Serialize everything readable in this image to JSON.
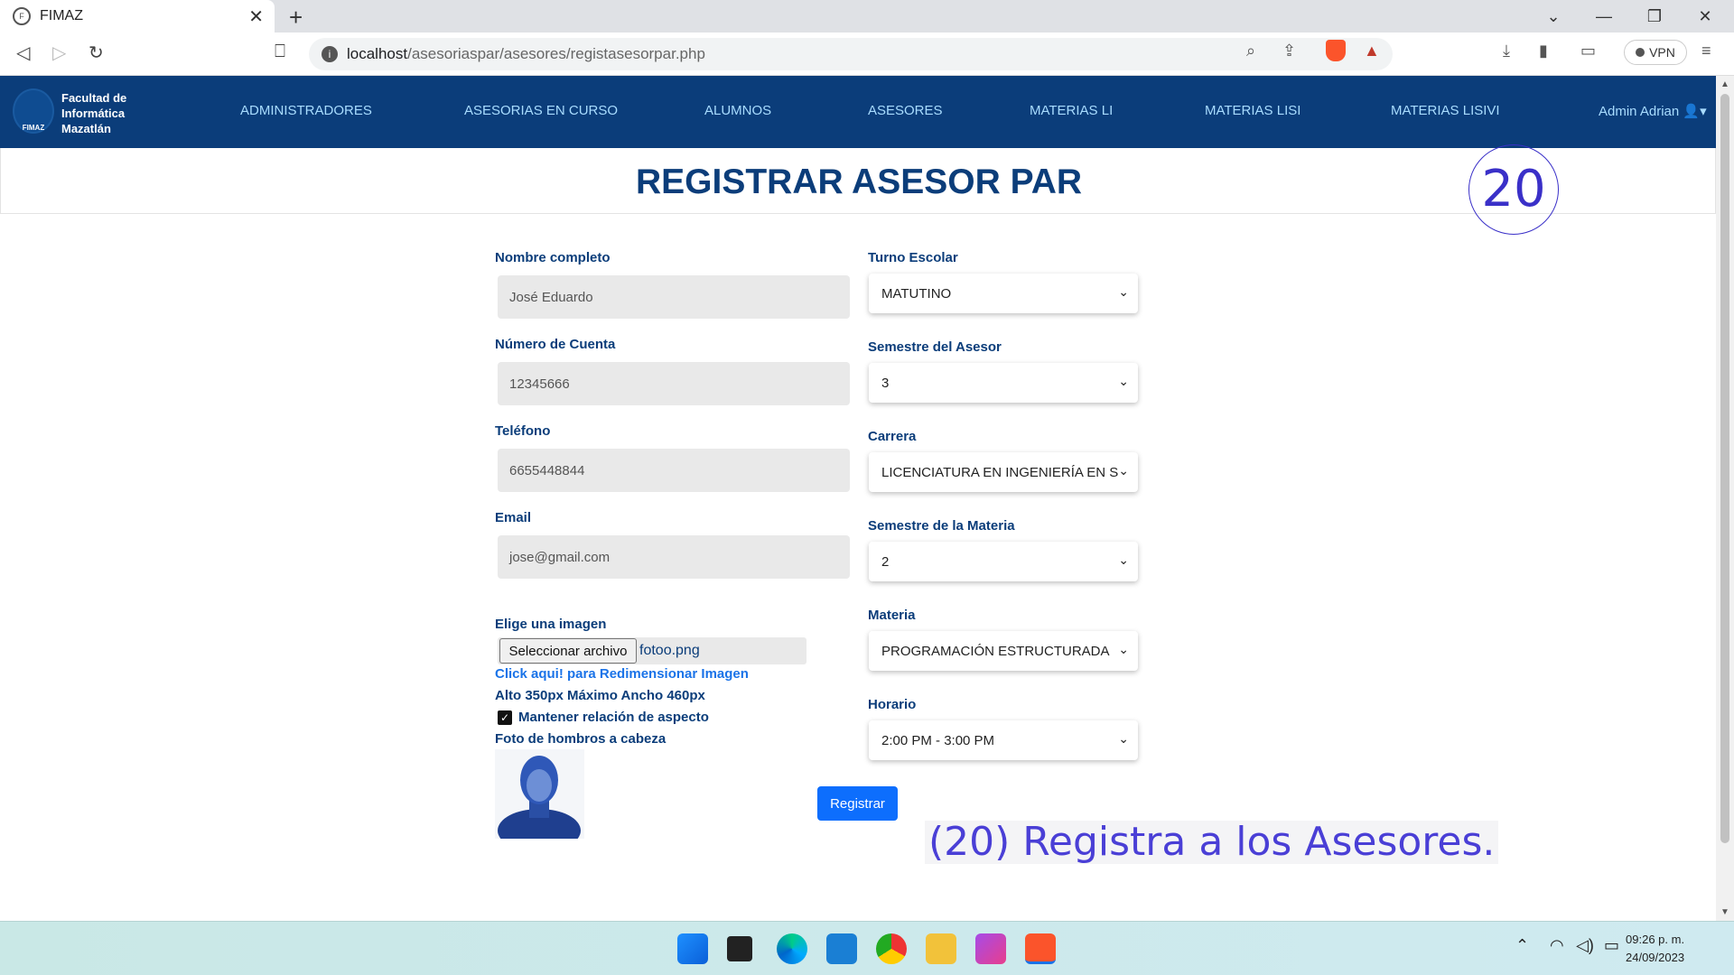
{
  "browser": {
    "tab_title": "FIMAZ",
    "url_host": "localhost",
    "url_path": "/asesoriaspar/asesores/registasesorpar.php",
    "vpn_label": "VPN"
  },
  "navbar": {
    "brand_line1": "Facultad de",
    "brand_line2": "Informática",
    "brand_line3": "Mazatlán",
    "logo_text": "FIMAZ",
    "links": [
      "ADMINISTRADORES",
      "ASESORIAS EN CURSO",
      "ALUMNOS",
      "ASESORES",
      "MATERIAS LI",
      "MATERIAS LISI",
      "MATERIAS LISIVI"
    ],
    "user": "Admin Adrian"
  },
  "page_title": "REGISTRAR ASESOR PAR",
  "annotation": {
    "badge": "20",
    "caption": "(20) Registra a los Asesores."
  },
  "form": {
    "nombre_label": "Nombre completo",
    "nombre_value": "José Eduardo",
    "cuenta_label": "Número de Cuenta",
    "cuenta_value": "12345666",
    "telefono_label": "Teléfono",
    "telefono_value": "6655448844",
    "email_label": "Email",
    "email_value": "jose@gmail.com",
    "imagen_label": "Elige una imagen",
    "file_button": "Seleccionar archivo",
    "file_name": "fotoo.png",
    "resize_link": "Click aqui! para Redimensionar Imagen",
    "size_note": "Alto 350px Máximo Ancho 460px",
    "aspect_label": "Mantener relación de aspecto",
    "photo_note": "Foto de hombros a cabeza",
    "turno_label": "Turno Escolar",
    "turno_value": "MATUTINO",
    "semestre_asesor_label": "Semestre del Asesor",
    "semestre_asesor_value": "3",
    "carrera_label": "Carrera",
    "carrera_value": "LICENCIATURA EN INGENIERÍA EN S",
    "semestre_materia_label": "Semestre de la Materia",
    "semestre_materia_value": "2",
    "materia_label": "Materia",
    "materia_value": "PROGRAMACIÓN ESTRUCTURADA",
    "horario_label": "Horario",
    "horario_value": "2:00 PM - 3:00 PM",
    "submit": "Registrar"
  },
  "taskbar": {
    "time": "09:26 p. m.",
    "date": "24/09/2023"
  }
}
